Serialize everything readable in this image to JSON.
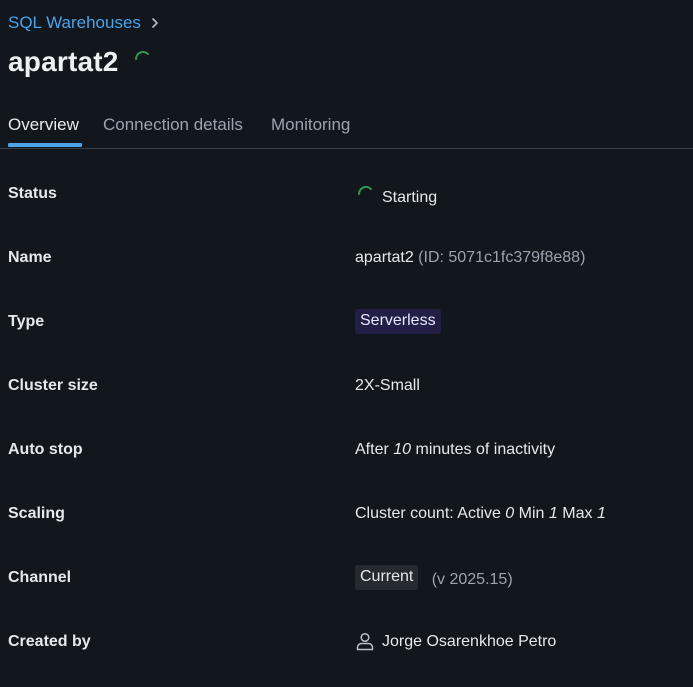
{
  "breadcrumb": {
    "parent_label": "SQL Warehouses"
  },
  "page": {
    "title": "apartat2"
  },
  "tabs": [
    {
      "label": "Overview",
      "active": true
    },
    {
      "label": "Connection details",
      "active": false
    },
    {
      "label": "Monitoring",
      "active": false
    }
  ],
  "details": {
    "status": {
      "label": "Status",
      "value": "Starting"
    },
    "name": {
      "label": "Name",
      "value": "apartat2",
      "id_text": "(ID: 5071c1fc379f8e88)"
    },
    "type": {
      "label": "Type",
      "value": "Serverless"
    },
    "cluster_size": {
      "label": "Cluster size",
      "value": "2X-Small"
    },
    "auto_stop": {
      "label": "Auto stop",
      "prefix": "After",
      "minutes": "10",
      "suffix": "minutes of inactivity"
    },
    "scaling": {
      "label": "Scaling",
      "prefix": "Cluster count: Active",
      "active": "0",
      "min_label": "Min",
      "min": "1",
      "max_label": "Max",
      "max": "1"
    },
    "channel": {
      "label": "Channel",
      "value": "Current",
      "version": "(v 2025.15)"
    },
    "created_by": {
      "label": "Created by",
      "value": "Jorge Osarenkhoe Petro"
    }
  },
  "colors": {
    "background": "#12171e",
    "link": "#4ba3e8",
    "spinner": "#2f9a52",
    "serverless_badge_bg": "#221e46",
    "channel_badge_bg": "#262b31"
  },
  "icons": {
    "breadcrumb_separator": "chevron-right-icon",
    "loading": "spinner-icon",
    "user": "user-icon"
  }
}
